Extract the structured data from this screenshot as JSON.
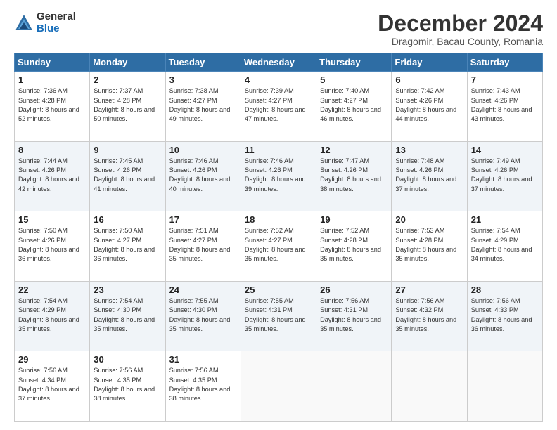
{
  "logo": {
    "general": "General",
    "blue": "Blue"
  },
  "title": "December 2024",
  "subtitle": "Dragomir, Bacau County, Romania",
  "days_header": [
    "Sunday",
    "Monday",
    "Tuesday",
    "Wednesday",
    "Thursday",
    "Friday",
    "Saturday"
  ],
  "weeks": [
    [
      {
        "num": "1",
        "sunrise": "Sunrise: 7:36 AM",
        "sunset": "Sunset: 4:28 PM",
        "daylight": "Daylight: 8 hours and 52 minutes."
      },
      {
        "num": "2",
        "sunrise": "Sunrise: 7:37 AM",
        "sunset": "Sunset: 4:28 PM",
        "daylight": "Daylight: 8 hours and 50 minutes."
      },
      {
        "num": "3",
        "sunrise": "Sunrise: 7:38 AM",
        "sunset": "Sunset: 4:27 PM",
        "daylight": "Daylight: 8 hours and 49 minutes."
      },
      {
        "num": "4",
        "sunrise": "Sunrise: 7:39 AM",
        "sunset": "Sunset: 4:27 PM",
        "daylight": "Daylight: 8 hours and 47 minutes."
      },
      {
        "num": "5",
        "sunrise": "Sunrise: 7:40 AM",
        "sunset": "Sunset: 4:27 PM",
        "daylight": "Daylight: 8 hours and 46 minutes."
      },
      {
        "num": "6",
        "sunrise": "Sunrise: 7:42 AM",
        "sunset": "Sunset: 4:26 PM",
        "daylight": "Daylight: 8 hours and 44 minutes."
      },
      {
        "num": "7",
        "sunrise": "Sunrise: 7:43 AM",
        "sunset": "Sunset: 4:26 PM",
        "daylight": "Daylight: 8 hours and 43 minutes."
      }
    ],
    [
      {
        "num": "8",
        "sunrise": "Sunrise: 7:44 AM",
        "sunset": "Sunset: 4:26 PM",
        "daylight": "Daylight: 8 hours and 42 minutes."
      },
      {
        "num": "9",
        "sunrise": "Sunrise: 7:45 AM",
        "sunset": "Sunset: 4:26 PM",
        "daylight": "Daylight: 8 hours and 41 minutes."
      },
      {
        "num": "10",
        "sunrise": "Sunrise: 7:46 AM",
        "sunset": "Sunset: 4:26 PM",
        "daylight": "Daylight: 8 hours and 40 minutes."
      },
      {
        "num": "11",
        "sunrise": "Sunrise: 7:46 AM",
        "sunset": "Sunset: 4:26 PM",
        "daylight": "Daylight: 8 hours and 39 minutes."
      },
      {
        "num": "12",
        "sunrise": "Sunrise: 7:47 AM",
        "sunset": "Sunset: 4:26 PM",
        "daylight": "Daylight: 8 hours and 38 minutes."
      },
      {
        "num": "13",
        "sunrise": "Sunrise: 7:48 AM",
        "sunset": "Sunset: 4:26 PM",
        "daylight": "Daylight: 8 hours and 37 minutes."
      },
      {
        "num": "14",
        "sunrise": "Sunrise: 7:49 AM",
        "sunset": "Sunset: 4:26 PM",
        "daylight": "Daylight: 8 hours and 37 minutes."
      }
    ],
    [
      {
        "num": "15",
        "sunrise": "Sunrise: 7:50 AM",
        "sunset": "Sunset: 4:26 PM",
        "daylight": "Daylight: 8 hours and 36 minutes."
      },
      {
        "num": "16",
        "sunrise": "Sunrise: 7:50 AM",
        "sunset": "Sunset: 4:27 PM",
        "daylight": "Daylight: 8 hours and 36 minutes."
      },
      {
        "num": "17",
        "sunrise": "Sunrise: 7:51 AM",
        "sunset": "Sunset: 4:27 PM",
        "daylight": "Daylight: 8 hours and 35 minutes."
      },
      {
        "num": "18",
        "sunrise": "Sunrise: 7:52 AM",
        "sunset": "Sunset: 4:27 PM",
        "daylight": "Daylight: 8 hours and 35 minutes."
      },
      {
        "num": "19",
        "sunrise": "Sunrise: 7:52 AM",
        "sunset": "Sunset: 4:28 PM",
        "daylight": "Daylight: 8 hours and 35 minutes."
      },
      {
        "num": "20",
        "sunrise": "Sunrise: 7:53 AM",
        "sunset": "Sunset: 4:28 PM",
        "daylight": "Daylight: 8 hours and 35 minutes."
      },
      {
        "num": "21",
        "sunrise": "Sunrise: 7:54 AM",
        "sunset": "Sunset: 4:29 PM",
        "daylight": "Daylight: 8 hours and 34 minutes."
      }
    ],
    [
      {
        "num": "22",
        "sunrise": "Sunrise: 7:54 AM",
        "sunset": "Sunset: 4:29 PM",
        "daylight": "Daylight: 8 hours and 35 minutes."
      },
      {
        "num": "23",
        "sunrise": "Sunrise: 7:54 AM",
        "sunset": "Sunset: 4:30 PM",
        "daylight": "Daylight: 8 hours and 35 minutes."
      },
      {
        "num": "24",
        "sunrise": "Sunrise: 7:55 AM",
        "sunset": "Sunset: 4:30 PM",
        "daylight": "Daylight: 8 hours and 35 minutes."
      },
      {
        "num": "25",
        "sunrise": "Sunrise: 7:55 AM",
        "sunset": "Sunset: 4:31 PM",
        "daylight": "Daylight: 8 hours and 35 minutes."
      },
      {
        "num": "26",
        "sunrise": "Sunrise: 7:56 AM",
        "sunset": "Sunset: 4:31 PM",
        "daylight": "Daylight: 8 hours and 35 minutes."
      },
      {
        "num": "27",
        "sunrise": "Sunrise: 7:56 AM",
        "sunset": "Sunset: 4:32 PM",
        "daylight": "Daylight: 8 hours and 35 minutes."
      },
      {
        "num": "28",
        "sunrise": "Sunrise: 7:56 AM",
        "sunset": "Sunset: 4:33 PM",
        "daylight": "Daylight: 8 hours and 36 minutes."
      }
    ],
    [
      {
        "num": "29",
        "sunrise": "Sunrise: 7:56 AM",
        "sunset": "Sunset: 4:34 PM",
        "daylight": "Daylight: 8 hours and 37 minutes."
      },
      {
        "num": "30",
        "sunrise": "Sunrise: 7:56 AM",
        "sunset": "Sunset: 4:35 PM",
        "daylight": "Daylight: 8 hours and 38 minutes."
      },
      {
        "num": "31",
        "sunrise": "Sunrise: 7:56 AM",
        "sunset": "Sunset: 4:35 PM",
        "daylight": "Daylight: 8 hours and 38 minutes."
      },
      null,
      null,
      null,
      null
    ]
  ]
}
